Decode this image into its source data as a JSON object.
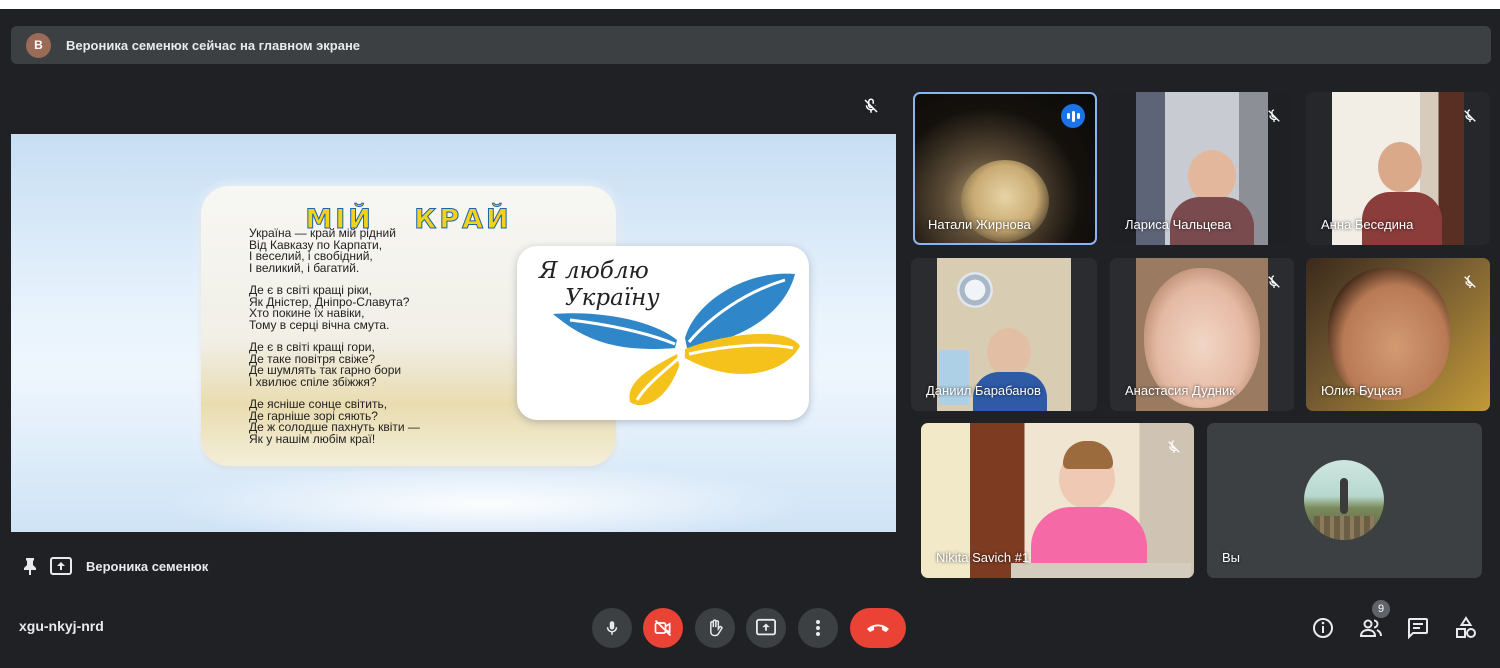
{
  "banner": {
    "avatar_letter": "В",
    "text": "Вероника семенюк сейчас на главном экране"
  },
  "presentation": {
    "title": "МІЙ КРАЙ",
    "stanzas": [
      [
        "Україна — край мій рідний",
        "Від Кавказу по Карпати,",
        "І веселий, і свобідний,",
        "І великий, і багатий."
      ],
      [
        "Де є в світі кращі ріки,",
        "Як Дністер, Дніпро-Славута?",
        "Хто покине їх навіки,",
        "Тому в серці вічна смута."
      ],
      [
        "Де є в світі кращі гори,",
        "Де таке повітря свіже?",
        "Де шумлять так гарно бори",
        "І хвилює спіле збіжжя?"
      ],
      [
        "Де ясніше сонце світить,",
        "Де гарніше зорі сяють?",
        "Де ж солодше пахнуть квіти —",
        "Як у нашім любім краї!"
      ]
    ],
    "love_line1": "Я люблю",
    "love_line2": "Україну"
  },
  "presenter": {
    "name": "Вероника семенюк"
  },
  "participants": [
    {
      "name": "Натали Жирнова",
      "speaking": true
    },
    {
      "name": "Лариса Чальцева",
      "muted": true
    },
    {
      "name": "Анна Беседина",
      "muted": true
    },
    {
      "name": "Даниил Барабанов",
      "muted": false
    },
    {
      "name": "Анастасия Дудник",
      "muted": true
    },
    {
      "name": "Юлия Буцкая",
      "muted": true
    },
    {
      "name": "Nikita Savich #1",
      "muted": true
    },
    {
      "name": "Вы",
      "muted": false
    }
  ],
  "bottom_bar": {
    "meeting_code": "xgu-nkyj-nrd",
    "participants_count": "9"
  },
  "icons": {
    "mic": "mic-icon",
    "camera_off": "videocam-off-icon",
    "hand": "raise-hand-icon",
    "present": "present-screen-icon",
    "more": "more-vert-icon",
    "hangup": "call-end-icon",
    "info": "info-icon",
    "people": "people-icon",
    "chat": "chat-icon",
    "activities": "activities-icon"
  },
  "colors": {
    "background": "#202124",
    "surface": "#3c4043",
    "accent": "#8ab4f8",
    "danger": "#ea4335",
    "speaking": "#1a73e8"
  }
}
